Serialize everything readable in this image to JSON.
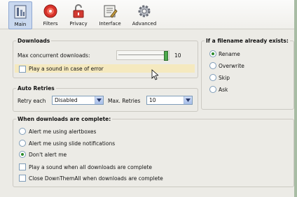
{
  "tabs": [
    {
      "label": "Main",
      "icon": "main-icon"
    },
    {
      "label": "Filters",
      "icon": "filters-icon"
    },
    {
      "label": "Privacy",
      "icon": "privacy-icon"
    },
    {
      "label": "Interface",
      "icon": "interface-icon"
    },
    {
      "label": "Advanced",
      "icon": "advanced-icon"
    }
  ],
  "downloads": {
    "title": "Downloads",
    "max_label": "Max concurrent downloads:",
    "max_value": "10",
    "slider_level": 10,
    "play_sound_label": "Play a sound in case of error"
  },
  "retries": {
    "title": "Auto Retries",
    "retry_label": "Retry each",
    "retry_value": "Disabled",
    "max_label": "Max. Retries",
    "max_value": "10"
  },
  "filename": {
    "title": "If a filename already exists:",
    "options": [
      "Rename",
      "Overwrite",
      "Skip",
      "Ask"
    ],
    "selected": "Rename"
  },
  "complete": {
    "title": "When downloads are complete:",
    "options": [
      "Alert me using alertboxes",
      "Alert me using slide notifications",
      "Don't alert me"
    ],
    "selected": "Don't alert me",
    "play_sound_label": "Play a sound when all downloads are complete",
    "close_label": "Close DownThemAll when downloads are complete"
  },
  "colors": {
    "accent": "#c9d8ef",
    "background": "#ecebe6",
    "highlight": "#f5e9bf",
    "radio_dot": "#2a8a2a"
  }
}
